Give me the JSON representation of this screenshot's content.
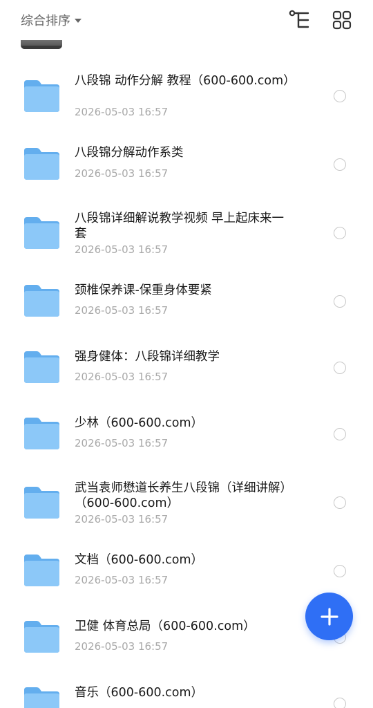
{
  "toolbar": {
    "sort_label": "综合排序",
    "tree_icon": "tree-view-icon",
    "grid_icon": "grid-view-icon"
  },
  "colors": {
    "accent": "#2f6ff5",
    "folder": "#6fb5f0",
    "date_text": "#a8a8a8"
  },
  "files": [
    {
      "name": "八段锦 动作分解 教程（600-600.com）",
      "date": "2026-05-03 16:57"
    },
    {
      "name": "八段锦分解动作系类",
      "date": "2026-05-03 16:57"
    },
    {
      "name": "八段锦详细解说教学视频 早上起床来一套",
      "date": "2026-05-03 16:57"
    },
    {
      "name": "颈椎保养课-保重身体要紧",
      "date": "2026-05-03 16:57"
    },
    {
      "name": "强身健体：八段锦详细教学",
      "date": "2026-05-03 16:57"
    },
    {
      "name": "少林（600-600.com）",
      "date": "2026-05-03 16:57"
    },
    {
      "name": "武当袁师懋道长养生八段锦（详细讲解）（600-600.com）",
      "date": "2026-05-03 16:57"
    },
    {
      "name": "文档（600-600.com）",
      "date": "2026-05-03 16:57"
    },
    {
      "name": "卫健 体育总局（600-600.com）",
      "date": "2026-05-03 16:57"
    },
    {
      "name": "音乐（600-600.com）",
      "date": ""
    }
  ],
  "fab": {
    "icon": "plus-icon"
  }
}
